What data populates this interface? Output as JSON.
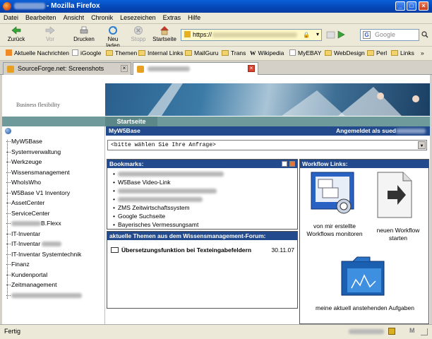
{
  "window": {
    "title": "Mozilla Firefox",
    "title_prefix": "- "
  },
  "menu": [
    "Datei",
    "Bearbeiten",
    "Ansicht",
    "Chronik",
    "Lesezeichen",
    "Extras",
    "Hilfe"
  ],
  "toolbar": {
    "back": "Zurück",
    "forward": "Vor",
    "print": "Drucken",
    "reload": "Neu laden",
    "stop": "Stopp",
    "home": "Startseite",
    "url_scheme": "https://",
    "search_placeholder": "Google"
  },
  "bookmarks_bar": [
    "Aktuelle Nachrichten",
    "iGoogle",
    "Themen",
    "Internal Links",
    "MailGuru",
    "Trans",
    "Wikipedia",
    "MyEBAY",
    "WebDesign",
    "Perl",
    "Links"
  ],
  "tabs": [
    {
      "label": "SourceForge.net: Screenshots",
      "active": false
    },
    {
      "label": "",
      "active": true
    }
  ],
  "page": {
    "slogan": "Business flexibility",
    "nav_tab": "Startseite",
    "header_left": "MyW5Base",
    "header_right": "Angemeldet als sued",
    "select_value": "<bitte wählen Sie Ihre Anfrage>",
    "tree_root": "",
    "tree": [
      "MyW5Base",
      "Systemverwaltung",
      "Werkzeuge",
      "Wissensmanagement",
      "WhoIsWho",
      "W5Base V1 Inventory",
      "AssetCenter",
      "ServiceCenter",
      "B.Flexx",
      "IT-Inventar",
      "IT-Inventar",
      "IT-Inventar Systemtechnik",
      "Finanz",
      "Kundenportal",
      "Zeitmanagement"
    ],
    "bookmarks": {
      "title": "Bookmarks:",
      "items": [
        "W5Base Video-Link",
        "ZMS Zeitwirtschaftssystem",
        "Google Suchseite",
        "Bayerisches Vermessungsamt"
      ]
    },
    "forum": {
      "title": "aktuelle Themen aus dem Wissensmanagement-Forum:",
      "items": [
        {
          "title": "Übersetzungsfunktion bei Texteingabefeldern",
          "date": "30.11.07"
        }
      ]
    },
    "workflow": {
      "title": "Workflow Links:",
      "item1": "von mir erstellte Workflows monitoren",
      "item2": "neuen Workflow starten",
      "item3": "meine aktuell anstehenden Aufgaben"
    }
  },
  "status": {
    "text": "Fertig"
  },
  "colors": {
    "header_blue": "#224a8c",
    "teal": "#6f9a9c",
    "url_bg": "#fff8c8"
  }
}
